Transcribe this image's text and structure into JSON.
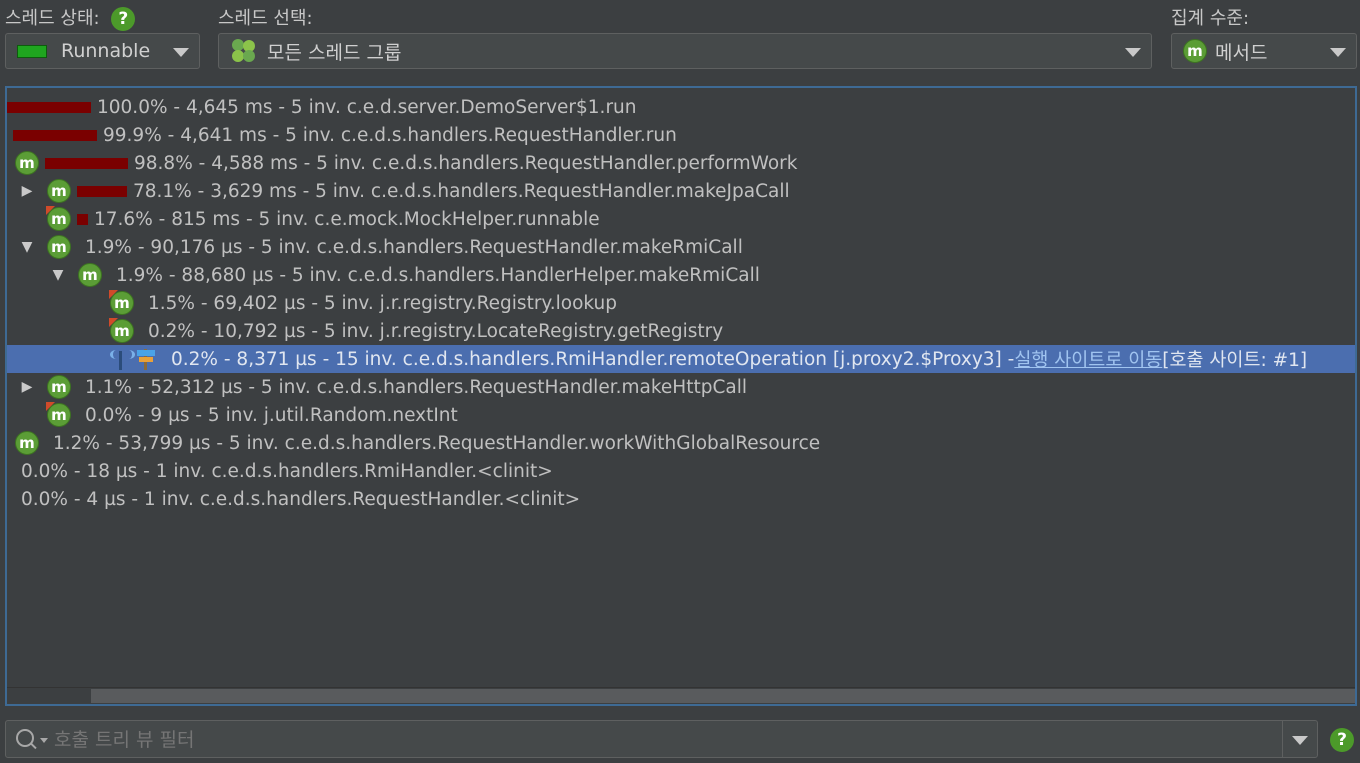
{
  "thread_state": {
    "label": "스레드 상태:",
    "value": "Runnable",
    "swatch_color": "#1fa51f"
  },
  "thread_select": {
    "label": "스레드 선택:",
    "value": "모든 스레드 그룹"
  },
  "aggregation": {
    "label": "집계 수준:",
    "value": "메서드"
  },
  "help_glyph": "?",
  "method_glyph": "m",
  "rows": [
    {
      "text": "100.0% - 4,645 ms - 5 inv. c.e.d.server.DemoServer$1.run",
      "bar_fraction": 1.0
    },
    {
      "text": "99.9% - 4,641 ms - 5 inv. c.e.d.s.handlers.RequestHandler.run",
      "bar_fraction": 0.999
    },
    {
      "text": "98.8% - 4,588 ms - 5 inv. c.e.d.s.handlers.RequestHandler.performWork",
      "bar_fraction": 0.988
    },
    {
      "text": "78.1% - 3,629 ms - 5 inv. c.e.d.s.handlers.RequestHandler.makeJpaCall",
      "bar_fraction": 0.781,
      "expander": "▶"
    },
    {
      "text": "17.6% - 815 ms - 5 inv. c.e.mock.MockHelper.runnable",
      "bar_fraction": 0.176
    },
    {
      "text": "1.9% - 90,176 µs - 5 inv. c.e.d.s.handlers.RequestHandler.makeRmiCall",
      "expander": "▼"
    },
    {
      "text": "1.9% - 88,680 µs - 5 inv. c.e.d.s.handlers.HandlerHelper.makeRmiCall",
      "expander": "▼"
    },
    {
      "text": "1.5% - 69,402 µs - 5 inv. j.r.registry.Registry.lookup"
    },
    {
      "text": "0.2% - 10,792 µs - 5 inv. j.r.registry.LocateRegistry.getRegistry"
    },
    {
      "text": "0.2% - 8,371 µs - 15 inv. c.e.d.s.handlers.RmiHandler.remoteOperation [j.proxy2.$Proxy3] - ",
      "link": "실행 사이트로 이동",
      "suffix": " [호출 사이트: #1]"
    },
    {
      "text": "1.1% - 52,312 µs - 5 inv. c.e.d.s.handlers.RequestHandler.makeHttpCall",
      "expander": "▶"
    },
    {
      "text": "0.0% - 9 µs - 5 inv. j.util.Random.nextInt"
    },
    {
      "text": "1.2% - 53,799 µs - 5 inv. c.e.d.s.handlers.RequestHandler.workWithGlobalResource"
    },
    {
      "text": "0.0% - 18 µs - 1 inv. c.e.d.s.handlers.RmiHandler.<clinit>"
    },
    {
      "text": "0.0% - 4 µs - 1 inv. c.e.d.s.handlers.RequestHandler.<clinit>"
    }
  ],
  "filter": {
    "placeholder": "호출 트리 뷰 필터"
  },
  "colors": {
    "bar": "#7a0000",
    "selection": "#4b6eaf",
    "method_icon": "#5b9d36",
    "help": "#4c9a2a"
  }
}
